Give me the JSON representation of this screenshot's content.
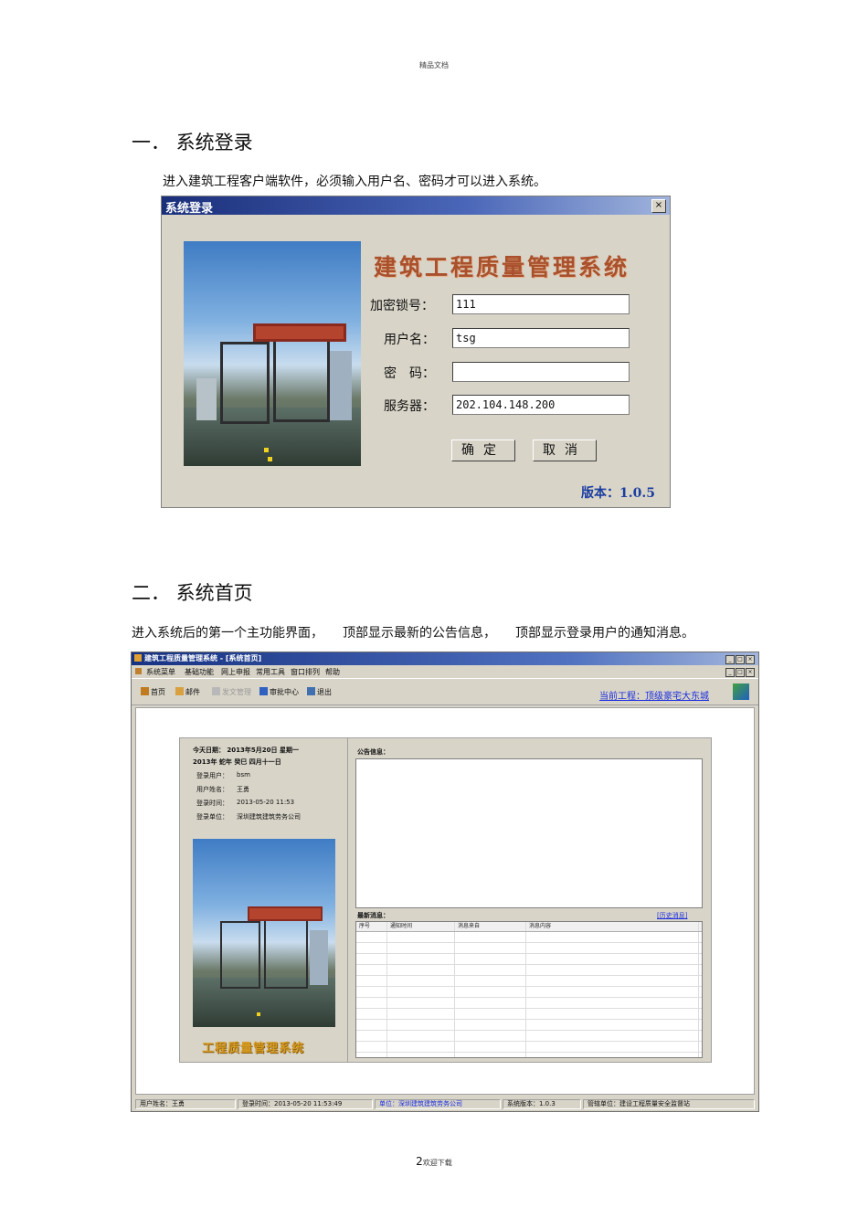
{
  "header_note": "精品文档",
  "section1": {
    "heading": "一． 系统登录",
    "text": "进入建筑工程客户端软件，必须输入用户名、密码才可以进入系统。"
  },
  "login_dialog": {
    "title": "系统登录",
    "close": "×",
    "app_title": "建筑工程质量管理系统",
    "fields": [
      {
        "label": "加密锁号：",
        "value": "111"
      },
      {
        "label": "用户名：",
        "value": "tsg"
      },
      {
        "label": "密　码：",
        "value": ""
      },
      {
        "label": "服务器：",
        "value": "202.104.148.200"
      }
    ],
    "ok_label": "确定",
    "cancel_label": "取消",
    "version": "版本：1.0.5"
  },
  "section2": {
    "heading": "二． 系统首页",
    "text": "进入系统后的第一个主功能界面，　　顶部显示最新的公告信息，　　顶部显示登录用户的通知消息。"
  },
  "main_window": {
    "title": "建筑工程质量管理系统 - [系统首页]",
    "menu": [
      "系统菜单",
      "基础功能",
      "网上申报",
      "常用工具",
      "窗口排列",
      "帮助"
    ],
    "toolbar": [
      {
        "label": "首页",
        "enabled": true,
        "icon": "home-icon"
      },
      {
        "label": "邮件",
        "enabled": true,
        "icon": "mail-icon"
      },
      {
        "label": "发文管理",
        "enabled": false,
        "icon": "doc-icon"
      },
      {
        "label": "审批中心",
        "enabled": true,
        "icon": "user-icon"
      },
      {
        "label": "退出",
        "enabled": true,
        "icon": "exit-icon"
      }
    ],
    "current_project": "当前工程：顶级豪宅大东城",
    "panel": {
      "date_line1": "今天日期： 2013年5月20日 星期一",
      "date_line2": "2013年 蛇年 癸巳 四月十一日",
      "info": [
        {
          "label": "登录用户：",
          "value": "bsm"
        },
        {
          "label": "用户姓名：",
          "value": "王勇"
        },
        {
          "label": "登录时间：",
          "value": "2013-05-20 11:53"
        },
        {
          "label": "登录单位：",
          "value": "深圳建筑建筑劳务公司"
        }
      ],
      "brand_text": "工程质量管理系统",
      "notice_label": "公告信息：",
      "messages_label": "最新消息：",
      "history_link": "[历史消息]",
      "columns": [
        "序号",
        "通知时间",
        "消息来自",
        "消息内容"
      ]
    },
    "statusbar": [
      "用户姓名：王勇",
      "登录时间：2013-05-20 11:53:49",
      "单位：深圳建筑建筑劳务公司",
      "系统版本：1.0.3",
      "管辖单位：建设工程质量安全监督站"
    ]
  },
  "footer": {
    "page_number": "2",
    "text": "欢迎下载"
  },
  "colors": {
    "title_bar": "#1a2f7a",
    "dialog_bg": "#d8d4c8",
    "app_title": "#a9502c",
    "link": "#1b2ee0"
  }
}
